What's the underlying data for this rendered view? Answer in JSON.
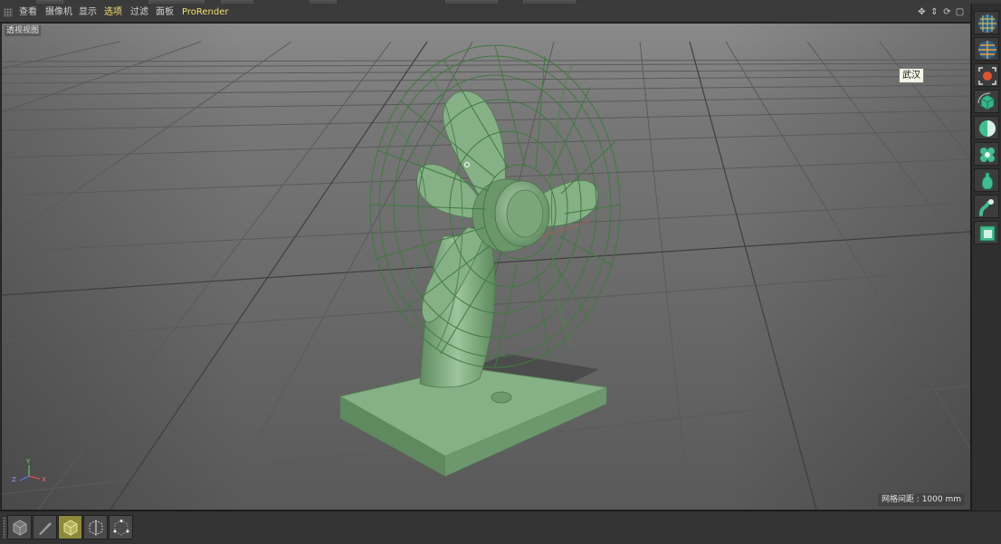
{
  "menu": {
    "items": [
      {
        "label": "查看",
        "highlighted": false
      },
      {
        "label": "摄像机",
        "highlighted": false
      },
      {
        "label": "显示",
        "highlighted": false
      },
      {
        "label": "选项",
        "highlighted": true
      },
      {
        "label": "过滤",
        "highlighted": false
      },
      {
        "label": "面板",
        "highlighted": false
      },
      {
        "label": "ProRender",
        "highlighted": true
      }
    ],
    "nav_icons": [
      "move-view-icon",
      "dolly-view-icon",
      "rotate-view-icon",
      "maximize-view-icon"
    ]
  },
  "viewport": {
    "label": "透视视图",
    "grid_info": "网格间距 : 1000 mm",
    "tooltip": "武汉",
    "axis_labels": {
      "x": "X",
      "y": "Y",
      "z": "Z"
    },
    "background_color": "#6e6e6e",
    "model_color": "#7fa87f",
    "wire_color": "#3f7a3f"
  },
  "right_palette": {
    "buttons": [
      {
        "icon": "sphere-grid-icon"
      },
      {
        "icon": "sphere-grid-selected-icon"
      },
      {
        "icon": "object-center-icon"
      },
      {
        "icon": "cube-rotate-icon"
      },
      {
        "icon": "half-sphere-icon"
      },
      {
        "icon": "cluster-icon"
      },
      {
        "icon": "vase-icon"
      },
      {
        "icon": "bend-icon"
      },
      {
        "icon": "box-icon"
      }
    ]
  },
  "bottom_toolbar": {
    "buttons": [
      {
        "icon": "cube-icon",
        "active": false
      },
      {
        "icon": "knife-icon",
        "active": false
      },
      {
        "icon": "polygon-cube-icon",
        "active": true
      },
      {
        "icon": "edge-select-icon",
        "active": false
      },
      {
        "icon": "point-select-icon",
        "active": false
      }
    ]
  }
}
